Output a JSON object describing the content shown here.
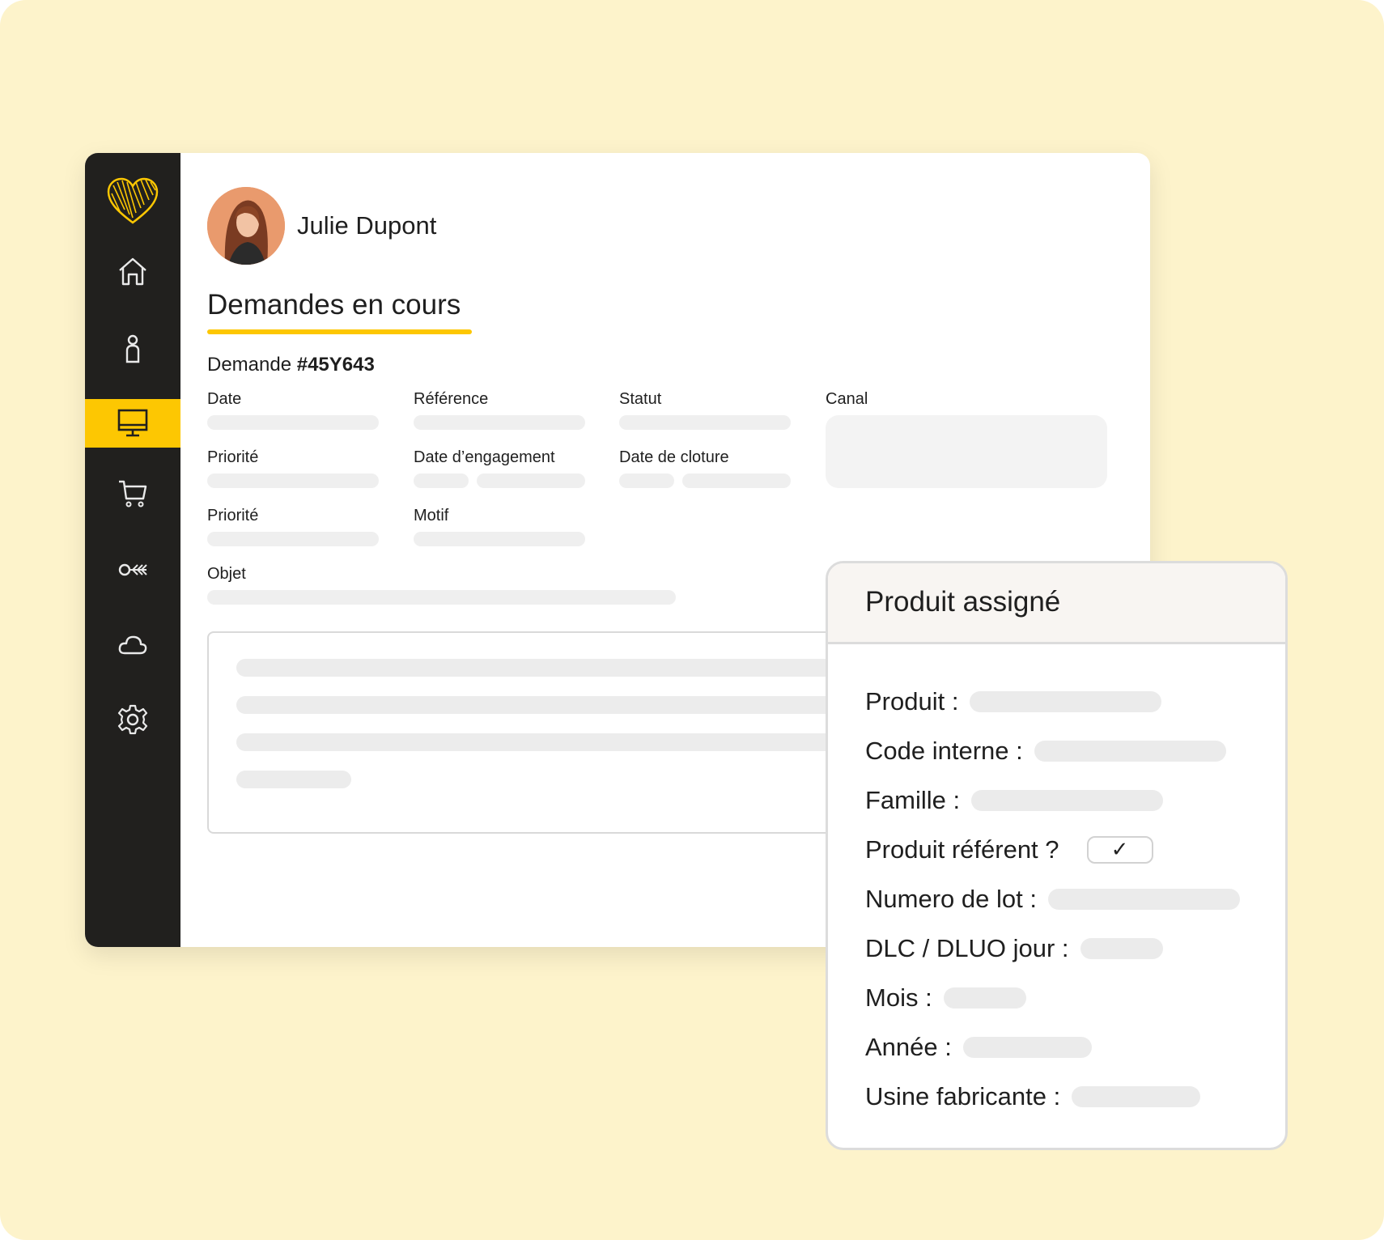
{
  "user": {
    "name": "Julie Dupont"
  },
  "section": {
    "title": "Demandes en cours"
  },
  "request": {
    "prefix": "Demande",
    "id": "#45Y643"
  },
  "fields": {
    "date": "Date",
    "reference": "Référence",
    "statut": "Statut",
    "canal": "Canal",
    "priorite": "Priorité",
    "date_engagement": "Date d’engagement",
    "date_cloture": "Date de cloture",
    "priorite_2": "Priorité",
    "motif": "Motif",
    "objet": "Objet"
  },
  "sidebar": {
    "items": [
      {
        "icon": "home-icon"
      },
      {
        "icon": "user-icon"
      },
      {
        "icon": "monitor-icon",
        "active": true
      },
      {
        "icon": "cart-icon"
      },
      {
        "icon": "key-icon"
      },
      {
        "icon": "cloud-icon"
      },
      {
        "icon": "gear-icon"
      }
    ]
  },
  "product_card": {
    "title": "Produit assigné",
    "rows": {
      "produit": "Produit :",
      "code_interne": "Code interne :",
      "famille": "Famille :",
      "produit_referent": "Produit référent ?",
      "numero_lot": "Numero de lot :",
      "dlc": "DLC / DLUO jour :",
      "mois": "Mois :",
      "annee": "Année :",
      "usine": "Usine fabricante :"
    },
    "referent_checked": true,
    "check_mark": "✓"
  },
  "colors": {
    "accent": "#fdc702",
    "sidebar": "#21201e",
    "background": "#fdf3cb"
  }
}
